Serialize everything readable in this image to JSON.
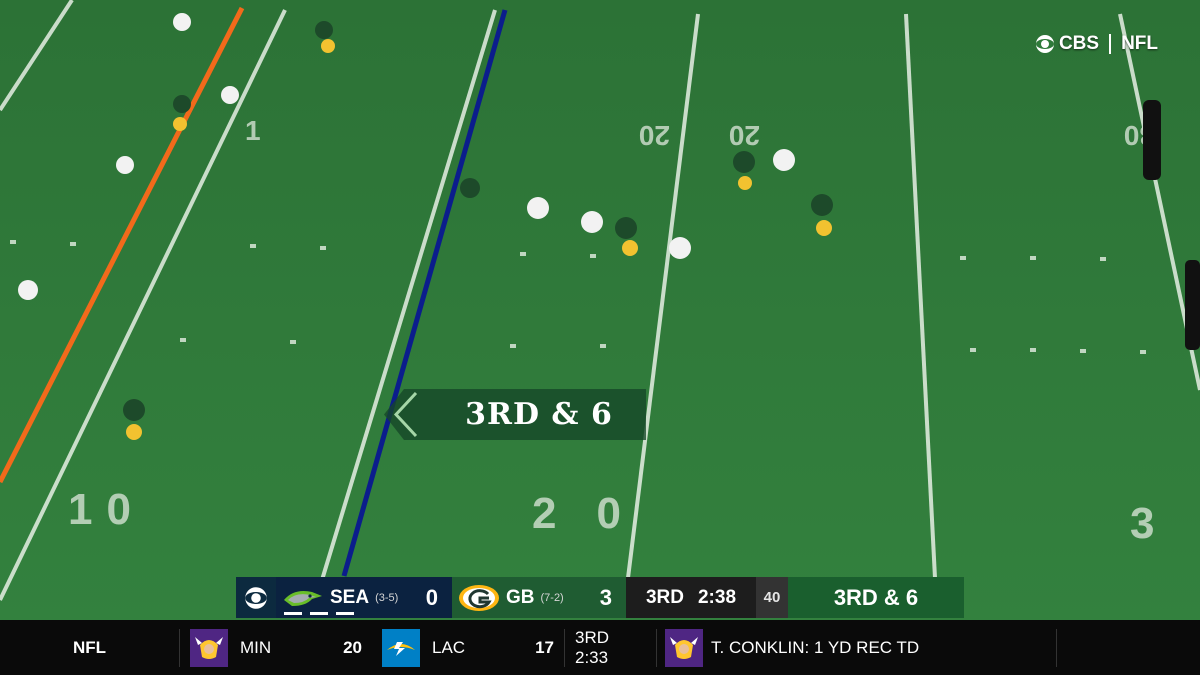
{
  "network": {
    "primary": "CBS",
    "secondary": "NFL"
  },
  "field": {
    "yard_numbers_upper": [
      "1",
      "20",
      "20",
      "30"
    ],
    "yard_numbers_lower": [
      "10",
      "20",
      "3"
    ]
  },
  "down_marker": {
    "down": "3RD",
    "distance": "6"
  },
  "scorebug": {
    "away": {
      "abbr": "SEA",
      "record": "(3-5)",
      "score": "0"
    },
    "home": {
      "abbr": "GB",
      "record": "(7-2)",
      "score": "3"
    },
    "quarter": "3RD",
    "clock": "2:38",
    "play_clock": "40",
    "down_distance": "3RD & 6"
  },
  "ticker": {
    "league": "NFL",
    "team1": {
      "abbr": "MIN",
      "score": "20"
    },
    "team2": {
      "abbr": "LAC",
      "score": "17"
    },
    "status": "3RD 2:33",
    "event": "T. CONKLIN: 1 YD REC TD"
  },
  "colors": {
    "turf": "#2f7a3a",
    "first_down_line": "#f26a1b",
    "scrimmage_line": "#0b1d8c",
    "sea_navy": "#0b2240",
    "gb_green": "#1f5c32"
  }
}
